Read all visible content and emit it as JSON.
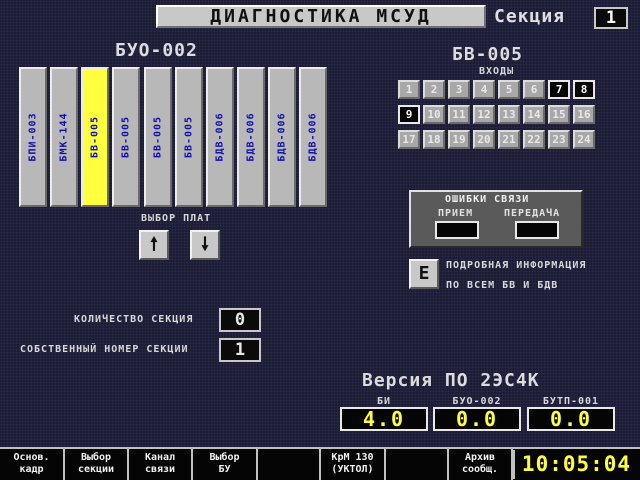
{
  "header": {
    "title": "ДИАГНОСТИКА МСУД",
    "section_label": "Секция",
    "section_value": "1"
  },
  "buo": {
    "title": "БУО-002",
    "cards": [
      {
        "label": "БПИ-003",
        "selected": false
      },
      {
        "label": "БМК-144",
        "selected": false
      },
      {
        "label": "БВ-005",
        "selected": true
      },
      {
        "label": "БВ-005",
        "selected": false
      },
      {
        "label": "БВ-005",
        "selected": false
      },
      {
        "label": "БВ-005",
        "selected": false
      },
      {
        "label": "БДВ-006",
        "selected": false
      },
      {
        "label": "БДВ-006",
        "selected": false
      },
      {
        "label": "БДВ-006",
        "selected": false
      },
      {
        "label": "БДВ-006",
        "selected": false
      }
    ],
    "select_label": "ВЫБОР ПЛАТ",
    "up_icon": "arrow-up-icon",
    "down_icon": "arrow-down-icon"
  },
  "bv": {
    "title": "БВ-005",
    "inputs_label": "ВХОДЫ",
    "inputs": [
      {
        "n": "1",
        "on": false
      },
      {
        "n": "2",
        "on": false
      },
      {
        "n": "3",
        "on": false
      },
      {
        "n": "4",
        "on": false
      },
      {
        "n": "5",
        "on": false
      },
      {
        "n": "6",
        "on": false
      },
      {
        "n": "7",
        "on": true
      },
      {
        "n": "8",
        "on": true
      },
      {
        "n": "9",
        "on": true
      },
      {
        "n": "10",
        "on": false
      },
      {
        "n": "11",
        "on": false
      },
      {
        "n": "12",
        "on": false
      },
      {
        "n": "13",
        "on": false
      },
      {
        "n": "14",
        "on": false
      },
      {
        "n": "15",
        "on": false
      },
      {
        "n": "16",
        "on": false
      },
      {
        "n": "17",
        "on": false
      },
      {
        "n": "18",
        "on": false
      },
      {
        "n": "19",
        "on": false
      },
      {
        "n": "20",
        "on": false
      },
      {
        "n": "21",
        "on": false
      },
      {
        "n": "22",
        "on": false
      },
      {
        "n": "23",
        "on": false
      },
      {
        "n": "24",
        "on": false
      }
    ]
  },
  "comm_errors": {
    "title": "ОШИБКИ СВЯЗИ",
    "rx_label": "ПРИЕМ",
    "tx_label": "ПЕРЕДАЧА",
    "rx_value": "",
    "tx_value": ""
  },
  "details": {
    "button": "E",
    "line1": "ПОДРОБНАЯ ИНФОРМАЦИЯ",
    "line2": "ПО ВСЕМ БВ И БДВ"
  },
  "sections": {
    "count_label": "КОЛИЧЕСТВО СЕКЦИЯ",
    "count_value": "0",
    "own_label": "СОБСТВЕННЫЙ НОМЕР СЕКЦИИ",
    "own_value": "1"
  },
  "version": {
    "title": "Версия ПО 2ЭС4К",
    "items": [
      {
        "label": "БИ",
        "value": "4.0"
      },
      {
        "label": "БУО-002",
        "value": "0.0"
      },
      {
        "label": "БУТП-001",
        "value": "0.0"
      }
    ]
  },
  "bottom_bar": {
    "buttons": [
      {
        "l1": "Основ.",
        "l2": "кадр"
      },
      {
        "l1": "Выбор",
        "l2": "секции"
      },
      {
        "l1": "Канал",
        "l2": "связи"
      },
      {
        "l1": "Выбор",
        "l2": "БУ"
      },
      {
        "l1": "",
        "l2": ""
      },
      {
        "l1": "КрМ 130",
        "l2": "(УКТОЛ)"
      },
      {
        "l1": "",
        "l2": ""
      },
      {
        "l1": "Архив",
        "l2": "сообщ."
      }
    ],
    "clock": "10:05:04"
  },
  "colors": {
    "background": "#1c1c34",
    "accent_yellow": "#ffff40",
    "card_text": "#1010b0",
    "panel_gray": "#c8c8c8"
  }
}
